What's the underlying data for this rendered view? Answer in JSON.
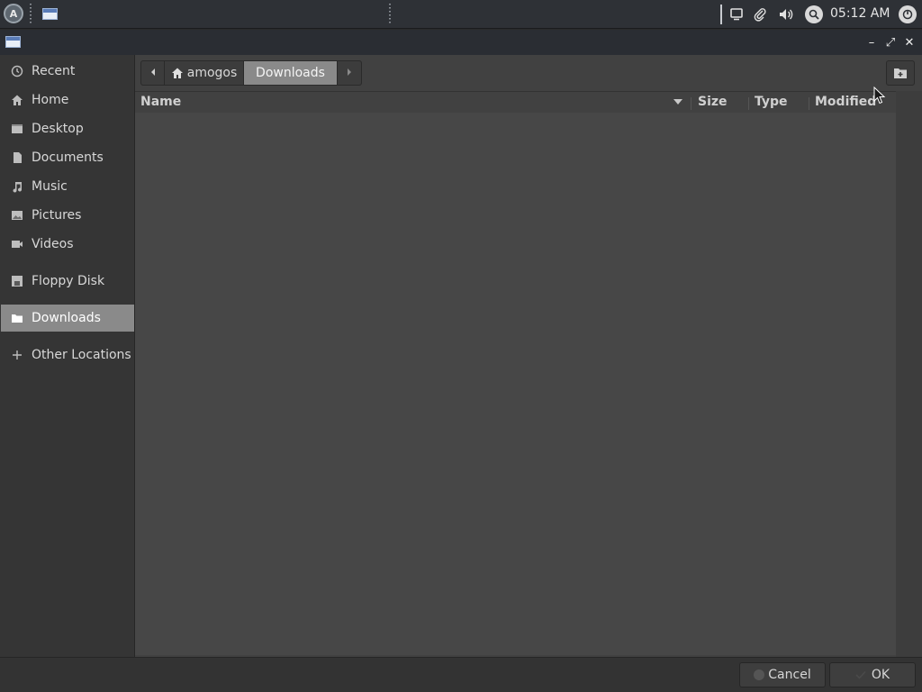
{
  "panel": {
    "logo_letter": "A",
    "clock": "05:12 AM"
  },
  "window": {
    "minimize": "–",
    "maximize": "⤢",
    "close": "✕"
  },
  "sidebar": {
    "items": [
      {
        "label": "Recent",
        "icon": "clock-icon"
      },
      {
        "label": "Home",
        "icon": "home-icon"
      },
      {
        "label": "Desktop",
        "icon": "desktop-icon"
      },
      {
        "label": "Documents",
        "icon": "document-icon"
      },
      {
        "label": "Music",
        "icon": "music-icon"
      },
      {
        "label": "Pictures",
        "icon": "picture-icon"
      },
      {
        "label": "Videos",
        "icon": "video-icon"
      },
      {
        "label": "Floppy Disk",
        "icon": "floppy-icon"
      },
      {
        "label": "Downloads",
        "icon": "folder-icon",
        "active": true
      },
      {
        "label": "Other Locations",
        "icon": "plus-icon"
      }
    ]
  },
  "pathbar": {
    "home_label": "amogos",
    "current_label": "Downloads"
  },
  "columns": {
    "name": "Name",
    "size": "Size",
    "type": "Type",
    "modified": "Modified"
  },
  "buttons": {
    "cancel": "Cancel",
    "ok": "OK"
  },
  "colors": {
    "accent_active": "#8a8a8a",
    "panel_bg": "#2e3136",
    "main_bg": "#474747"
  }
}
